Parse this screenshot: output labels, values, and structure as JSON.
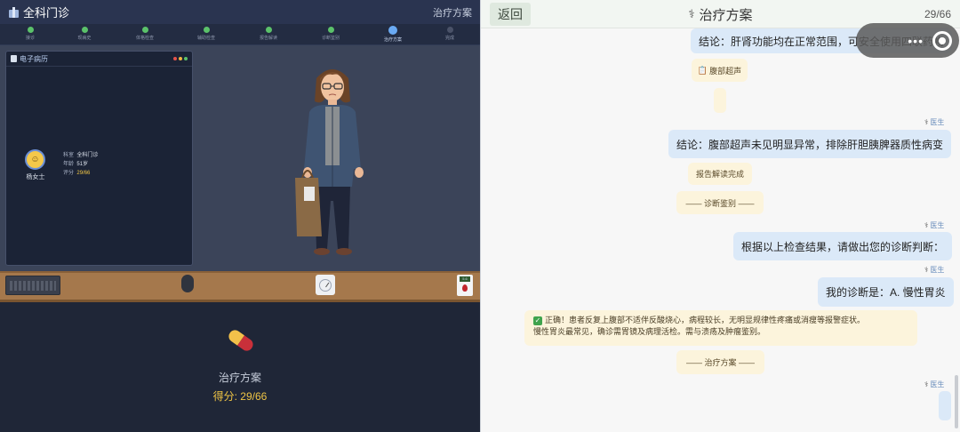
{
  "left": {
    "app_title": "全科门诊",
    "header_right": "治疗方案",
    "steps": [
      {
        "label": "接诊",
        "state": "done"
      },
      {
        "label": "现病史",
        "state": "done"
      },
      {
        "label": "体格检查",
        "state": "done"
      },
      {
        "label": "辅助检查",
        "state": "done"
      },
      {
        "label": "报告解读",
        "state": "done"
      },
      {
        "label": "诊断鉴别",
        "state": "done"
      },
      {
        "label": "治疗方案",
        "state": "active"
      },
      {
        "label": "完成",
        "state": "pending"
      }
    ],
    "emr": {
      "title": "电子病历",
      "patient_name": "杨女士",
      "dept_label": "科室",
      "dept_value": "全科门诊",
      "age_label": "年龄",
      "age_value": "51岁",
      "score_label": "评分",
      "score_value": "29/66"
    },
    "meter_reading": "5.6",
    "bottom": {
      "plan_label": "治疗方案",
      "score_text": "得分: 29/66"
    },
    "colors": {
      "done": "#5bc26a",
      "active": "#6aaaf3",
      "pending": "#4a5268",
      "score": "#f0c545"
    }
  },
  "right": {
    "back_label": "返回",
    "title": "治疗方案",
    "progress": "29/66",
    "messages": {
      "conclusion_kidney": "结论：肝肾功能均在正常范围，可安全使用四联药物",
      "tag_ultrasound": "腹部超声",
      "doctor_label": "医生",
      "conclusion_ultrasound": "结论：腹部超声未见明显异常，排除肝胆胰脾器质性病变",
      "tag_report_done": "报告解读完成",
      "tag_diff": "—— 诊断鉴别 ——",
      "prompt_diagnosis": "根据以上检查结果，请做出您的诊断判断：",
      "my_diagnosis": "我的诊断是：A. 慢性胃炎",
      "feedback_line1": "正确！患者反复上腹部不适伴反酸烧心，病程较长，无明显规律性疼痛或消瘦等报警症状。",
      "feedback_line2": "慢性胃炎最常见，确诊需胃镜及病理活检。需与溃疡及肿瘤鉴别。",
      "tag_plan": "—— 治疗方案 ——"
    },
    "icons": {
      "title_icon": "stethoscope-icon",
      "check": "check-icon"
    }
  }
}
